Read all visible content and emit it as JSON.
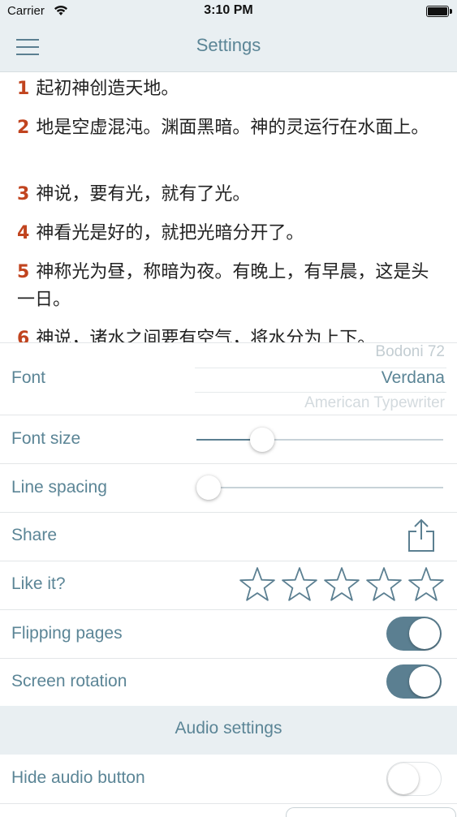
{
  "status_bar": {
    "carrier": "Carrier",
    "time": "3:10 PM",
    "wifi_icon": "wifi-icon",
    "battery_icon": "battery-icon"
  },
  "nav": {
    "title": "Settings",
    "menu_icon": "hamburger-menu-icon"
  },
  "verses": [
    {
      "number": "1",
      "text": "起初神创造天地。"
    },
    {
      "number": "2",
      "text": "地是空虚混沌。渊面黑暗。神的灵运行在水面上。"
    },
    {
      "number": "3",
      "text": "神说，要有光，就有了光。"
    },
    {
      "number": "4",
      "text": "神看光是好的，就把光暗分开了。"
    },
    {
      "number": "5",
      "text": "神称光为昼，称暗为夜。有晚上，有早晨，这是头一日。"
    },
    {
      "number": "6",
      "text": "神说，诸水之间要有空气，将水分为上下。"
    }
  ],
  "settings": {
    "font": {
      "label": "Font",
      "options": [
        "Bodoni 72",
        "Verdana",
        "American Typewriter"
      ],
      "selected": "Verdana"
    },
    "font_size": {
      "label": "Font size",
      "value": 0.24
    },
    "line_spacing": {
      "label": "Line spacing",
      "value": 0.0
    },
    "share": {
      "label": "Share",
      "icon": "share-icon"
    },
    "like_it": {
      "label": "Like it?",
      "stars_total": 5,
      "stars_filled": 0,
      "icon": "star-icon"
    },
    "flipping_pages": {
      "label": "Flipping pages",
      "on": true
    },
    "screen_rotation": {
      "label": "Screen rotation",
      "on": true
    },
    "audio_section": {
      "label": "Audio settings"
    },
    "hide_audio_button": {
      "label": "Hide audio button",
      "on": false
    }
  },
  "colors": {
    "accent": "#5b7f91",
    "label": "#5b8596",
    "verse_number": "#c1441f",
    "bar_bg": "#e9eff2"
  }
}
